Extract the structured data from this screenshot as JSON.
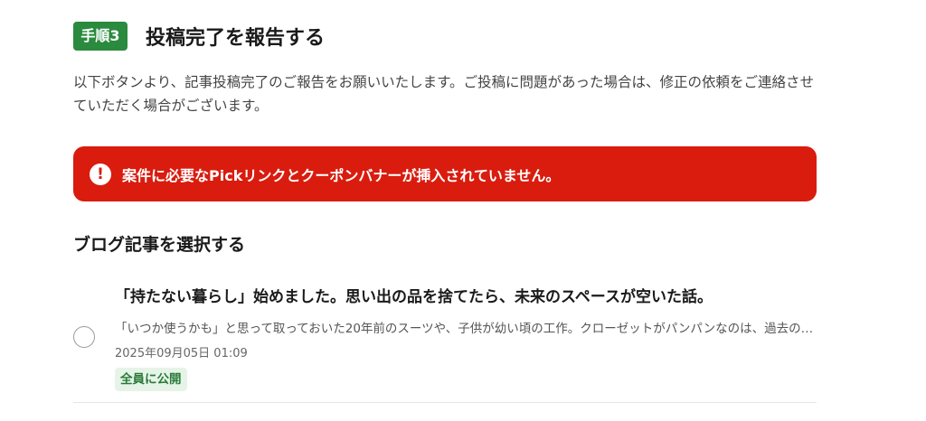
{
  "step": {
    "badge": "手順3",
    "title": "投稿完了を報告する"
  },
  "description": "以下ボタンより、記事投稿完了のご報告をお願いいたします。ご投稿に問題があった場合は、修正の依頼をご連絡させていただく場合がございます。",
  "error": {
    "icon": "exclamation-icon",
    "icon_glyph": "!",
    "text": "案件に必要なPickリンクとクーポンバナーが挿入されていません。",
    "color": "#d91c0e"
  },
  "section": {
    "title": "ブログ記事を選択する"
  },
  "articles": [
    {
      "title": "「持たない暮らし」始めました。思い出の品を捨てたら、未来のスペースが空いた話。",
      "excerpt": "「いつか使うかも」と思って取っておいた20年前のスーツや、子供が幼い頃の工作。クローゼットがパンパンなのは、過去の…",
      "date": "2025年09月05日 01:09",
      "visibility": "全員に公開",
      "selected": false
    }
  ],
  "colors": {
    "accent_green": "#2a8a3e",
    "error_red": "#d91c0e",
    "badge_bg": "#e6f4e8"
  }
}
